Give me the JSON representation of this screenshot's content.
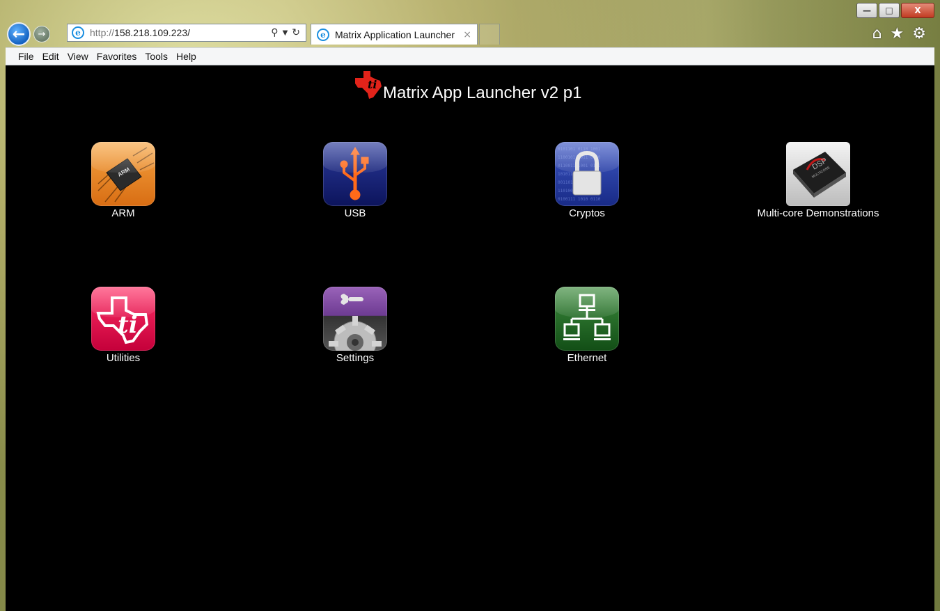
{
  "browser": {
    "window_controls": {
      "minimize": "—",
      "maximize": "□",
      "close": "X"
    },
    "address": {
      "protocol": "http://",
      "host": "158.218.109.223/"
    },
    "tab": {
      "title": "Matrix Application Launcher",
      "close": "×"
    },
    "menu": [
      "File",
      "Edit",
      "View",
      "Favorites",
      "Tools",
      "Help"
    ],
    "icons": {
      "back": "back-arrow-icon",
      "forward": "forward-arrow-icon",
      "home": "home-icon",
      "favorites": "star-icon",
      "tools": "gear-icon"
    }
  },
  "page": {
    "title": "Matrix App Launcher v2 p1",
    "logo_color": "#e2231a",
    "apps": [
      {
        "label": "ARM",
        "icon": "arm-chip-icon",
        "color": "#f08a2c"
      },
      {
        "label": "USB",
        "icon": "usb-icon",
        "color": "#1a237e"
      },
      {
        "label": "Cryptos",
        "icon": "padlock-icon",
        "color": "#2a3fa8"
      },
      {
        "label": "Multi-core Demonstrations",
        "icon": "dsp-chip-icon",
        "color": "#d9d9d9"
      },
      {
        "label": "Utilities",
        "icon": "ti-logo-icon",
        "color": "#e8164f"
      },
      {
        "label": "Settings",
        "icon": "gear-wrench-icon",
        "color": "#7b4a9e"
      },
      {
        "label": "Ethernet",
        "icon": "network-icon",
        "color": "#2e7d32"
      }
    ]
  }
}
